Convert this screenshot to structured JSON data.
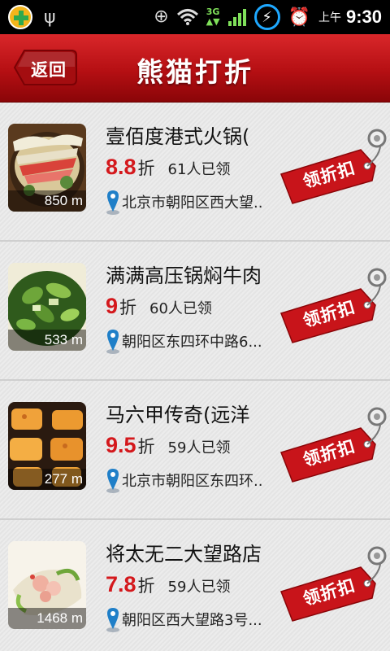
{
  "statusbar": {
    "ampm": "上午",
    "time": "9:30",
    "network": "3G",
    "icons": [
      "360-plus-icon",
      "usb-icon",
      "gps-icon",
      "wifi-icon",
      "3g-icon",
      "signal-icon",
      "charging-icon",
      "alarm-icon"
    ]
  },
  "header": {
    "back_label": "返回",
    "title": "熊猫打折"
  },
  "colors": {
    "header_red": "#c0171b",
    "discount_red": "#d4181c",
    "coupon_red": "#c8141a",
    "pin_blue": "#1f7fc8"
  },
  "deals": [
    {
      "name": "壹佰度港式火锅(",
      "discount": "8.8",
      "unit": "折",
      "claimed": "61人已领",
      "address": "北京市朝阳区西大望..",
      "distance": "850 m",
      "coupon_label": "领折扣",
      "thumb": "hotpot"
    },
    {
      "name": "满满高压锅焖牛肉",
      "discount": "9",
      "unit": "折",
      "claimed": "60人已领",
      "address": "朝阳区东四环中路6...",
      "distance": "533 m",
      "coupon_label": "领折扣",
      "thumb": "greens"
    },
    {
      "name": "马六甲传奇(远洋",
      "discount": "9.5",
      "unit": "折",
      "claimed": "59人已领",
      "address": "北京市朝阳区东四环..",
      "distance": "277 m",
      "coupon_label": "领折扣",
      "thumb": "sushi"
    },
    {
      "name": "将太无二大望路店",
      "discount": "7.8",
      "unit": "折",
      "claimed": "59人已领",
      "address": "朝阳区西大望路3号...",
      "distance": "1468 m",
      "coupon_label": "领折扣",
      "thumb": "salad"
    }
  ]
}
